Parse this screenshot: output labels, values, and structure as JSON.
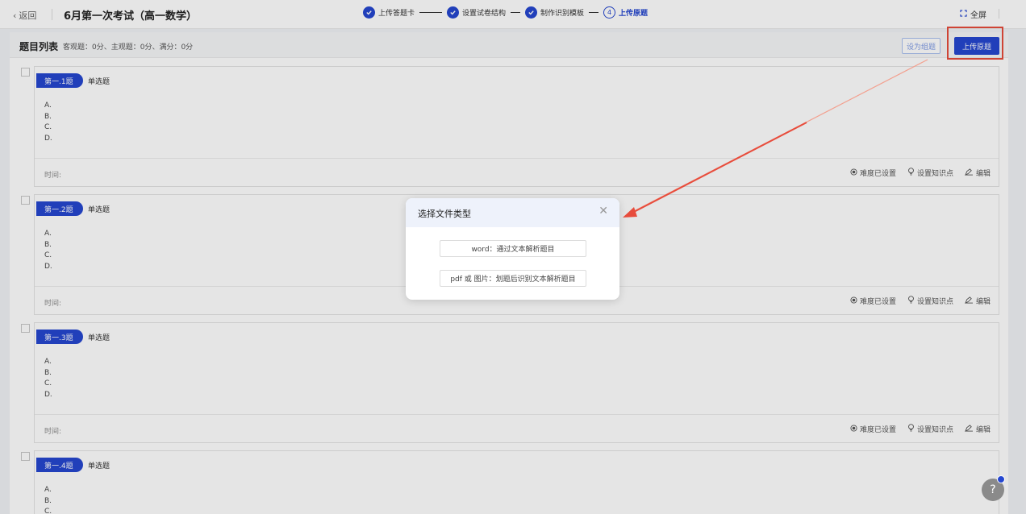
{
  "header": {
    "back_label": "返回",
    "exam_title": "6月第一次考试（高一数学）",
    "steps": [
      {
        "label": "上传答题卡"
      },
      {
        "label": "设置试卷结构"
      },
      {
        "label": "制作识别模板"
      },
      {
        "number": "4",
        "label": "上传原题"
      }
    ],
    "fullscreen_label": "全屏"
  },
  "list": {
    "title": "题目列表",
    "stats": "客观题：0分、主观题：0分、满分：0分",
    "group_btn": "设为组题",
    "upload_btn": "上传原题"
  },
  "questions": [
    {
      "tag": "第一.1题",
      "type": "单选题",
      "time_label": "时间:"
    },
    {
      "tag": "第一.2题",
      "type": "单选题",
      "time_label": "时间:"
    },
    {
      "tag": "第一.3题",
      "type": "单选题",
      "time_label": "时间:"
    },
    {
      "tag": "第一.4题",
      "type": "单选题",
      "time_label": ""
    }
  ],
  "options": [
    "A.",
    "B.",
    "C.",
    "D."
  ],
  "actions": {
    "difficulty": "难度已设置",
    "knowledge": "设置知识点",
    "edit": "编辑"
  },
  "modal": {
    "title": "选择文件类型",
    "option_word": "word：通过文本解析题目",
    "option_pdf": "pdf 或 图片：划题后识别文本解析题目"
  },
  "help_label": "?",
  "colors": {
    "primary": "#2547d0",
    "annotation": "#e74c3c"
  }
}
